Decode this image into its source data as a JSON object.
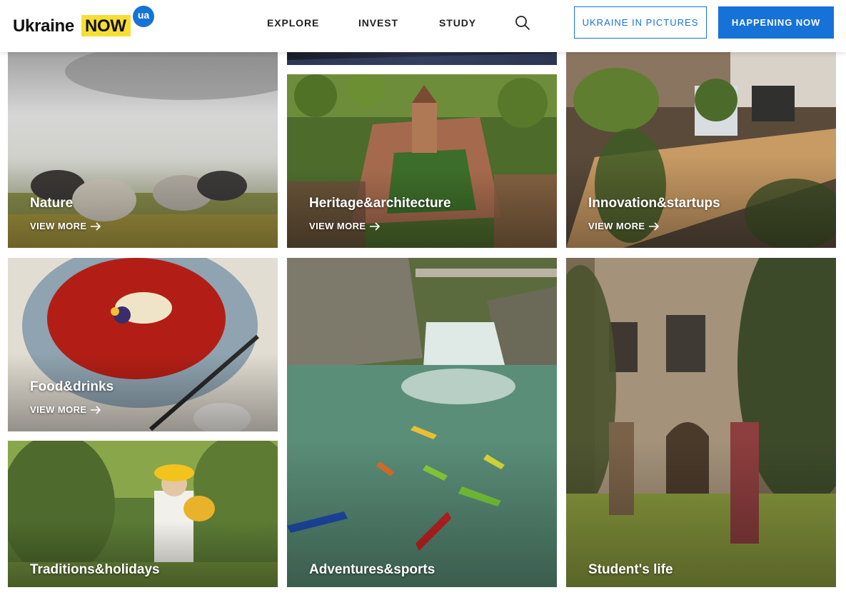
{
  "header": {
    "logo": {
      "word": "Ukraine",
      "highlight": "NOW",
      "badge": "ua"
    },
    "nav": [
      {
        "label": "EXPLORE"
      },
      {
        "label": "INVEST"
      },
      {
        "label": "STUDY"
      }
    ],
    "search_icon": "search-icon",
    "buttons": {
      "pictures": "UKRAINE IN PICTURES",
      "happening": "HAPPENING NOW"
    },
    "colors": {
      "accent_blue": "#1672d7",
      "logo_yellow": "#f6de36"
    }
  },
  "tiles": [
    {
      "title": "Nature",
      "more": "VIEW MORE"
    },
    {
      "title": "Heritage&architecture",
      "more": "VIEW MORE"
    },
    {
      "title": "Innovation&startups",
      "more": "VIEW MORE"
    },
    {
      "title": "Food&drinks",
      "more": "VIEW MORE"
    },
    {
      "title": "Adventures&sports"
    },
    {
      "title": "Student's life"
    },
    {
      "title": "Traditions&holidays"
    }
  ]
}
